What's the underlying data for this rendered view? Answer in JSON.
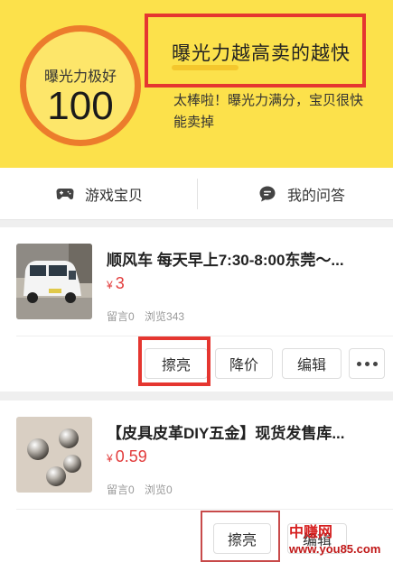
{
  "score": {
    "label": "曝光力极好",
    "value": "100"
  },
  "headline": "曝光力越高卖的越快",
  "subtext": "太棒啦！曝光力满分，宝贝很快能卖掉",
  "tabs": [
    {
      "label": "游戏宝贝",
      "icon": "gamepad-icon"
    },
    {
      "label": "我的问答",
      "icon": "chat-bubble-icon"
    }
  ],
  "items": [
    {
      "title": "顺风车 每天早上7:30-8:00东莞～...",
      "currency": "¥",
      "price": "3",
      "comments": "留言0",
      "views": "浏览343",
      "thumb": "white-car-photo",
      "actions": {
        "polish": "擦亮",
        "reduce": "降价",
        "edit": "编辑"
      }
    },
    {
      "title": "【皮具皮革DIY五金】现货发售库...",
      "currency": "¥",
      "price": "0.59",
      "comments": "留言0",
      "views": "浏览0",
      "thumb": "metal-beads-photo",
      "actions": {
        "polish": "擦亮",
        "edit": "编辑"
      }
    }
  ],
  "watermark": {
    "name": "中赚网",
    "url": "www.you85.com"
  },
  "colors": {
    "header_bg": "#fce14b",
    "ring": "#ec7c2c",
    "highlight_box": "#e53630",
    "price": "#e23c3c"
  }
}
